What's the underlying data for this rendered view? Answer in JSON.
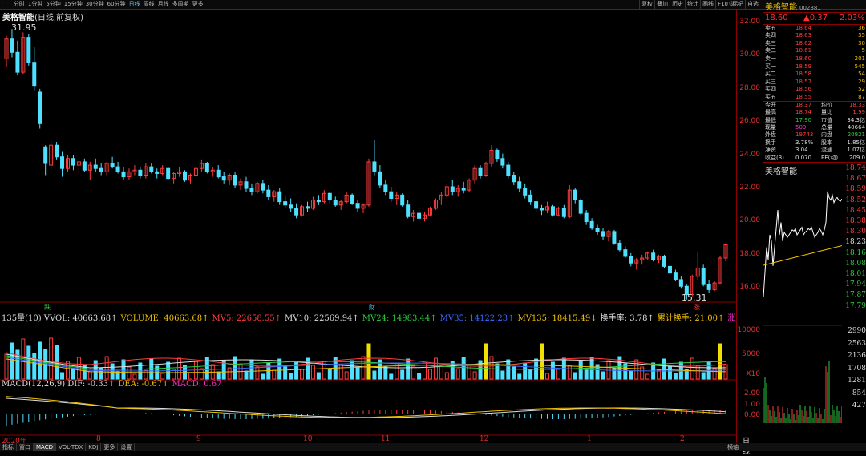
{
  "topbar": {
    "tabs": [
      "分时",
      "1分钟",
      "5分钟",
      "15分钟",
      "30分钟",
      "60分钟",
      "日线",
      "周线",
      "月线",
      "多周期",
      "更多"
    ],
    "active": "日线",
    "tools": [
      "复权",
      "叠加",
      "历史",
      "统计",
      "画线",
      "F10",
      "标记",
      "自选"
    ]
  },
  "stock": {
    "name": "美格智能",
    "mode": "(日线,前复权)",
    "code": "002881"
  },
  "price_axis": [
    "32.00",
    "30.00",
    "28.00",
    "26.00",
    "24.00",
    "22.00",
    "20.00",
    "18.00",
    "16.00"
  ],
  "vol_axis": [
    "10000",
    "5000",
    "X10"
  ],
  "macd_axis": [
    "2.00",
    "1.00",
    "0.00"
  ],
  "annotations": {
    "high": "31.95",
    "low": "15.31"
  },
  "markers": {
    "m1": "跌",
    "m2": "财",
    "m3": "涨"
  },
  "volume_line": [
    {
      "text": "135量(10) VVOL: 40663.68↑",
      "color": "#dddddd"
    },
    {
      "text": "VOLUME: 40663.68↑",
      "color": "#f0c000"
    },
    {
      "text": "MV5: 22658.55↑",
      "color": "#ff3b3b"
    },
    {
      "text": "MV10: 22569.94↑",
      "color": "#dddddd"
    },
    {
      "text": "MV24: 14983.44↑",
      "color": "#2ecc40"
    },
    {
      "text": "MV35: 14122.23↑",
      "color": "#3a6bff"
    },
    {
      "text": "MV135: 18415.49↓",
      "color": "#f0c000"
    },
    {
      "text": "换手率: 3.78↑",
      "color": "#dddddd"
    },
    {
      "text": "累计换手: 21.00↑",
      "color": "#f0c000"
    },
    {
      "text": "涨",
      "color": "#ff2bd6"
    }
  ],
  "macd_line": [
    {
      "text": "MACD(12,26,9) DIF: -0.33↑",
      "color": "#dddddd"
    },
    {
      "text": "DEA: -0.67↑",
      "color": "#f0c000"
    },
    {
      "text": "MACD: 0.67↑",
      "color": "#ff2bd6"
    }
  ],
  "dates": {
    "year": "2020年",
    "months": [
      "8",
      "9",
      "10",
      "11",
      "12",
      "1",
      "2"
    ],
    "label": "日线"
  },
  "bottom_tabs": [
    "指标",
    "窗口",
    "MACD",
    "VOL-TDX",
    "KDJ",
    "更多",
    "设置"
  ],
  "bottom_right": "横轴",
  "quote": {
    "price": "18.60",
    "change": "▲0.37",
    "pct": "2.03%"
  },
  "orderbook": {
    "sell": [
      [
        "卖五",
        "18.64",
        "36"
      ],
      [
        "卖四",
        "18.63",
        "35"
      ],
      [
        "卖三",
        "18.62",
        "30"
      ],
      [
        "卖二",
        "18.61",
        "5"
      ],
      [
        "卖一",
        "18.60",
        "201"
      ]
    ],
    "buy": [
      [
        "买一",
        "18.59",
        "545"
      ],
      [
        "买二",
        "18.58",
        "54"
      ],
      [
        "买三",
        "18.57",
        "29"
      ],
      [
        "买四",
        "18.56",
        "52"
      ],
      [
        "买五",
        "18.55",
        "87"
      ]
    ]
  },
  "stats": [
    [
      "今开",
      "18.37",
      "均价",
      "18.33"
    ],
    [
      "最高",
      "18.74",
      "量比",
      "1.99"
    ],
    [
      "最低",
      "17.90",
      "市值",
      "34.3亿"
    ],
    [
      "现量",
      "509",
      "总量",
      "40664"
    ],
    [
      "外盘",
      "19743",
      "内盘",
      "20921"
    ],
    [
      "换手",
      "3.78%",
      "股本",
      "1.85亿"
    ],
    [
      "净资",
      "3.04",
      "流通",
      "1.07亿"
    ],
    [
      "收益(3)",
      "0.070",
      "PE(动)",
      "209.0"
    ]
  ],
  "mini": {
    "title": "美格智能",
    "price_labels": [
      "18.74",
      "18.67",
      "18.59",
      "18.52",
      "18.45",
      "18.38",
      "18.30",
      "18.23",
      "18.16",
      "18.08",
      "18.01",
      "17.94",
      "17.87",
      "17.79"
    ],
    "vol_labels": [
      "2990",
      "2563",
      "2136",
      "1708",
      "1281",
      "854",
      "427"
    ]
  },
  "chart_data": {
    "type": "candlestick",
    "ohlc": [
      [
        29.8,
        31.2,
        29.3,
        31.0
      ],
      [
        31.0,
        31.6,
        29.9,
        30.2
      ],
      [
        30.2,
        30.9,
        28.8,
        29.0
      ],
      [
        29.0,
        31.4,
        28.9,
        31.1
      ],
      [
        31.1,
        31.3,
        29.4,
        29.6
      ],
      [
        29.6,
        30.5,
        27.9,
        28.2
      ],
      [
        27.8,
        28.0,
        25.6,
        25.9
      ],
      [
        24.5,
        24.6,
        22.8,
        23.5
      ],
      [
        23.4,
        24.9,
        23.1,
        24.6
      ],
      [
        24.6,
        24.8,
        23.7,
        23.9
      ],
      [
        23.9,
        24.2,
        22.7,
        23.2
      ],
      [
        23.2,
        24.0,
        23.0,
        23.8
      ],
      [
        23.8,
        24.0,
        23.1,
        23.4
      ],
      [
        23.4,
        23.8,
        22.9,
        23.6
      ],
      [
        23.6,
        23.8,
        23.0,
        23.1
      ],
      [
        23.1,
        23.6,
        22.5,
        23.4
      ],
      [
        23.4,
        23.8,
        23.0,
        23.2
      ],
      [
        23.2,
        23.5,
        22.8,
        23.0
      ],
      [
        23.0,
        23.6,
        22.8,
        23.5
      ],
      [
        23.5,
        23.9,
        23.2,
        23.3
      ],
      [
        23.3,
        23.6,
        22.9,
        23.0
      ],
      [
        23.0,
        23.3,
        22.5,
        22.7
      ],
      [
        22.7,
        23.2,
        22.5,
        23.0
      ],
      [
        23.0,
        23.4,
        22.8,
        23.1
      ],
      [
        23.1,
        23.3,
        22.6,
        22.8
      ],
      [
        22.8,
        23.5,
        22.6,
        23.3
      ],
      [
        23.3,
        23.5,
        22.9,
        23.0
      ],
      [
        23.0,
        23.2,
        22.6,
        22.9
      ],
      [
        22.9,
        23.4,
        22.8,
        23.2
      ],
      [
        23.2,
        23.3,
        22.5,
        22.6
      ],
      [
        22.6,
        23.0,
        22.3,
        22.9
      ],
      [
        22.9,
        23.3,
        22.7,
        23.0
      ],
      [
        23.0,
        23.1,
        22.4,
        22.5
      ],
      [
        22.5,
        22.9,
        22.3,
        22.8
      ],
      [
        22.8,
        23.3,
        22.6,
        23.2
      ],
      [
        23.2,
        23.7,
        23.0,
        23.5
      ],
      [
        23.5,
        23.6,
        22.9,
        23.0
      ],
      [
        23.0,
        23.3,
        22.7,
        23.1
      ],
      [
        23.1,
        23.4,
        22.6,
        22.7
      ],
      [
        22.7,
        23.0,
        22.3,
        22.5
      ],
      [
        22.5,
        22.9,
        22.2,
        22.8
      ],
      [
        22.8,
        23.0,
        22.0,
        22.2
      ],
      [
        22.2,
        22.6,
        21.9,
        22.4
      ],
      [
        22.4,
        22.7,
        21.8,
        22.0
      ],
      [
        22.0,
        22.3,
        21.6,
        21.8
      ],
      [
        21.8,
        22.4,
        21.7,
        22.3
      ],
      [
        22.3,
        22.5,
        21.7,
        21.9
      ],
      [
        21.9,
        22.2,
        21.3,
        21.5
      ],
      [
        21.5,
        21.9,
        21.2,
        21.8
      ],
      [
        21.8,
        22.0,
        21.0,
        21.2
      ],
      [
        21.2,
        21.5,
        20.8,
        21.0
      ],
      [
        21.0,
        21.4,
        20.6,
        20.8
      ],
      [
        20.8,
        21.1,
        20.2,
        20.4
      ],
      [
        20.4,
        21.0,
        20.3,
        20.9
      ],
      [
        20.9,
        21.2,
        20.6,
        20.8
      ],
      [
        20.8,
        21.5,
        20.7,
        21.3
      ],
      [
        21.3,
        21.6,
        21.0,
        21.2
      ],
      [
        21.2,
        21.9,
        21.1,
        21.7
      ],
      [
        21.7,
        21.8,
        21.1,
        21.3
      ],
      [
        21.3,
        21.5,
        20.9,
        21.0
      ],
      [
        21.0,
        21.3,
        20.7,
        21.2
      ],
      [
        21.2,
        21.8,
        21.1,
        21.6
      ],
      [
        21.6,
        21.7,
        21.0,
        21.1
      ],
      [
        21.1,
        21.3,
        20.6,
        20.8
      ],
      [
        20.8,
        21.1,
        20.5,
        21.0
      ],
      [
        21.0,
        23.8,
        20.9,
        23.6
      ],
      [
        23.6,
        24.9,
        22.8,
        23.0
      ],
      [
        23.0,
        23.4,
        22.0,
        22.2
      ],
      [
        22.2,
        22.5,
        21.6,
        21.8
      ],
      [
        21.8,
        22.1,
        21.2,
        21.4
      ],
      [
        21.4,
        21.8,
        21.0,
        21.6
      ],
      [
        21.6,
        21.7,
        20.9,
        21.0
      ],
      [
        21.0,
        21.3,
        20.2,
        20.3
      ],
      [
        20.3,
        20.7,
        20.0,
        20.5
      ],
      [
        20.5,
        20.8,
        20.1,
        20.2
      ],
      [
        20.2,
        20.6,
        20.0,
        20.4
      ],
      [
        20.4,
        20.9,
        20.3,
        20.8
      ],
      [
        20.8,
        21.4,
        20.7,
        21.3
      ],
      [
        21.3,
        21.8,
        21.0,
        21.6
      ],
      [
        21.6,
        22.3,
        21.4,
        22.1
      ],
      [
        22.1,
        22.5,
        21.6,
        21.8
      ],
      [
        21.8,
        22.2,
        21.5,
        22.0
      ],
      [
        22.0,
        22.4,
        21.7,
        21.9
      ],
      [
        21.9,
        22.6,
        21.8,
        22.5
      ],
      [
        22.5,
        23.4,
        22.3,
        23.2
      ],
      [
        23.2,
        23.4,
        22.6,
        22.8
      ],
      [
        22.8,
        23.6,
        22.7,
        23.5
      ],
      [
        23.5,
        24.6,
        23.3,
        24.3
      ],
      [
        24.3,
        24.4,
        23.6,
        23.8
      ],
      [
        23.8,
        24.1,
        23.2,
        23.4
      ],
      [
        23.4,
        23.6,
        22.6,
        22.8
      ],
      [
        22.8,
        23.0,
        22.2,
        22.4
      ],
      [
        22.4,
        22.7,
        21.8,
        22.0
      ],
      [
        22.0,
        22.3,
        21.4,
        21.6
      ],
      [
        21.6,
        21.9,
        21.0,
        21.2
      ],
      [
        21.2,
        21.4,
        20.6,
        20.8
      ],
      [
        20.8,
        21.0,
        20.4,
        20.7
      ],
      [
        20.7,
        21.2,
        20.5,
        20.9
      ],
      [
        20.9,
        21.0,
        20.3,
        20.4
      ],
      [
        20.4,
        20.9,
        20.3,
        20.8
      ],
      [
        20.8,
        21.0,
        20.2,
        20.3
      ],
      [
        20.3,
        22.2,
        20.2,
        21.9
      ],
      [
        21.9,
        22.0,
        21.1,
        21.3
      ],
      [
        21.3,
        21.4,
        20.4,
        20.5
      ],
      [
        20.5,
        20.7,
        19.8,
        20.0
      ],
      [
        20.0,
        20.2,
        19.5,
        19.6
      ],
      [
        19.6,
        19.8,
        19.2,
        19.4
      ],
      [
        19.4,
        19.6,
        18.9,
        19.1
      ],
      [
        19.1,
        19.5,
        18.8,
        19.4
      ],
      [
        19.4,
        19.5,
        18.6,
        18.7
      ],
      [
        18.7,
        18.9,
        18.2,
        18.3
      ],
      [
        18.3,
        18.5,
        17.8,
        17.9
      ],
      [
        17.9,
        18.1,
        17.3,
        17.5
      ],
      [
        17.5,
        17.8,
        17.1,
        17.7
      ],
      [
        17.7,
        18.0,
        17.4,
        17.8
      ],
      [
        17.8,
        18.2,
        17.7,
        18.1
      ],
      [
        18.1,
        18.3,
        17.6,
        17.7
      ],
      [
        17.7,
        18.0,
        17.5,
        17.9
      ],
      [
        17.9,
        18.0,
        17.2,
        17.3
      ],
      [
        17.3,
        17.5,
        16.8,
        16.9
      ],
      [
        16.9,
        17.1,
        16.4,
        16.5
      ],
      [
        16.5,
        16.7,
        16.0,
        16.1
      ],
      [
        16.1,
        16.2,
        15.3,
        15.6
      ],
      [
        15.6,
        16.8,
        15.5,
        16.7
      ],
      [
        16.7,
        18.2,
        16.5,
        17.2
      ],
      [
        17.2,
        17.4,
        16.1,
        16.2
      ],
      [
        16.2,
        16.5,
        15.7,
        15.9
      ],
      [
        15.9,
        16.4,
        15.8,
        16.3
      ],
      [
        16.3,
        17.9,
        16.2,
        17.8
      ],
      [
        17.8,
        18.7,
        17.6,
        18.6
      ]
    ],
    "ylim": [
      15,
      32
    ]
  }
}
